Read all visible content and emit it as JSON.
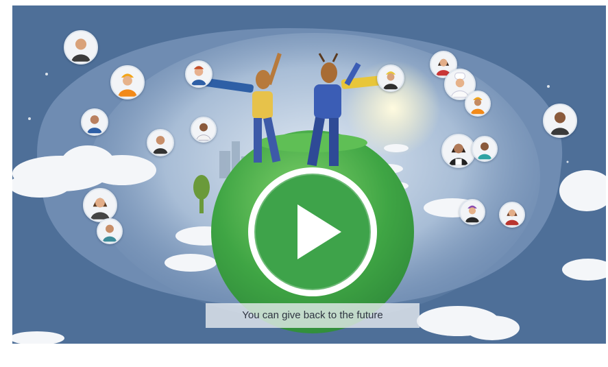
{
  "video": {
    "caption": "You can give back to the future",
    "play_icon": "play-icon"
  },
  "colors": {
    "sky": "#4e6f98",
    "globe": "#4cae4c",
    "play_ring": "#ffffff",
    "caption_bg": "#ebeef2"
  }
}
